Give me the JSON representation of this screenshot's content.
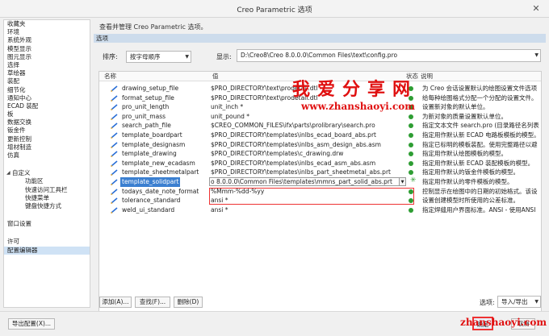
{
  "window": {
    "title": "Creo Parametric 选项",
    "close_glyph": "✕"
  },
  "nav": {
    "items": [
      "收藏夹",
      "环境",
      "系统外观",
      "模型显示",
      "图元显示",
      "选择",
      "草绘器",
      "装配",
      "细节化",
      "通知中心",
      "ECAD 装配",
      "板",
      "数据交换",
      "钣金件",
      "更新控制",
      "增材制造",
      "仿真"
    ],
    "customize": {
      "label": "自定义",
      "children": [
        "功能区",
        "快速访问工具栏",
        "快捷菜单",
        "键盘快捷方式"
      ]
    },
    "window_settings": "窗口设置",
    "license": "许可",
    "config_editor": "配置编辑器"
  },
  "panel": {
    "description": "查看并管理 Creo Parametric 选项。",
    "section": "选项",
    "sort_label": "排序:",
    "sort_value": "按字母顺序",
    "show_label": "显示:",
    "show_value": "D:\\Creo8\\Creo 8.0.0.0\\Common Files\\text\\config.pro"
  },
  "table": {
    "headers": {
      "name": "名称",
      "value": "值",
      "status": "状态",
      "desc": "说明"
    },
    "rows": [
      {
        "name": "drawing_setup_file",
        "value": "$PRO_DIRECTORY\\text\\prodetail.dtl",
        "desc": "为 Creo 会话设置默认的绘图设置文件选项"
      },
      {
        "name": "format_setup_file",
        "value": "$PRO_DIRECTORY\\text\\prodetail.dtl",
        "desc": "给每种绘图格式分配一个分配的设置文件。"
      },
      {
        "name": "pro_unit_length",
        "value": "unit_inch *",
        "desc": "设置新对象的默认单位。"
      },
      {
        "name": "pro_unit_mass",
        "value": "unit_pound *",
        "desc": "为新对象的质量设置默认单位。"
      },
      {
        "name": "search_path_file",
        "value": "$CREO_COMMON_FILES\\ifx\\parts\\prolibrary\\search.pro",
        "desc": "指定文本文件 search.pro (目录路径名列表"
      },
      {
        "name": "template_boardpart",
        "value": "$PRO_DIRECTORY\\templates\\inlbs_ecad_board_abs.prt",
        "desc": "指定用作默认新 ECAD 电路板模板的模型。"
      },
      {
        "name": "template_designasm",
        "value": "$PRO_DIRECTORY\\templates\\inlbs_asm_design_abs.asm",
        "desc": "指定已标明的模板装配。使用完整路径以避"
      },
      {
        "name": "template_drawing",
        "value": "$PRO_DIRECTORY\\templates\\c_drawing.drw",
        "desc": "指定用作默认绘图模板的模型。"
      },
      {
        "name": "template_new_ecadasm",
        "value": "$PRO_DIRECTORY\\templates\\inlbs_ecad_asm_abs.asm",
        "desc": "指定用作默认新 ECAD 装配模板的模型。"
      },
      {
        "name": "template_sheetmetalpart",
        "value": "$PRO_DIRECTORY\\templates\\inlbs_part_sheetmetal_abs.prt",
        "desc": "指定用作默认的钣金件模板的模型。"
      },
      {
        "name": "template_solidpart",
        "value": "o 8.0.0.0\\Common Files\\templates\\mmns_part_solid_abs.prt",
        "desc": "指定用作默认的零件模板的模型。"
      },
      {
        "name": "todays_date_note_format",
        "value": "%Mmm-%dd-%yy",
        "desc": "控制显示在绘图中的日期的初始格式。该设"
      },
      {
        "name": "tolerance_standard",
        "value": "ansi *",
        "desc": "设置创建模型时所使用的公差标准。"
      },
      {
        "name": "weld_ui_standard",
        "value": "ansi *",
        "desc": "指定焊缝用户界面标准。ANSI - 使用ANSI"
      }
    ]
  },
  "buttons": {
    "add": "添加(A)...",
    "find": "查找(F)...",
    "delete": "删除(D)",
    "options_label": "选项:",
    "import_export": "导入/导出",
    "export_config": "导出配置(X)...",
    "ok": "确定",
    "cancel": "取消"
  },
  "watermark": {
    "title": "我爱分享网",
    "url": "www.zhanshaoyi.com",
    "bottom": "zhanshaoyi.com"
  },
  "colors": {
    "accent": "#3b7fd0",
    "status_green": "#2e9d33",
    "watermark_red": "#e01010",
    "section_bar": "#cddcec"
  }
}
